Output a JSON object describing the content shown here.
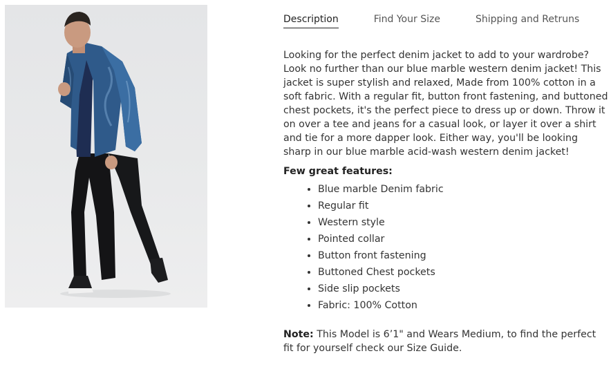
{
  "tabs": [
    {
      "label": "Description",
      "active": true
    },
    {
      "label": "Find Your Size",
      "active": false
    },
    {
      "label": "Shipping and Retruns",
      "active": false
    }
  ],
  "description": "Looking for the perfect denim jacket to add to your wardrobe? Look no further than our blue marble western denim jacket! This jacket is super stylish and relaxed, Made from 100% cotton in a soft fabric. With a regular fit, button front fastening, and buttoned chest pockets, it's the perfect piece to dress up or down. Throw it on over a tee and jeans for a casual look, or layer it over a shirt and tie for a more dapper look. Either way, you'll be looking sharp in our blue marble acid-wash western denim jacket!",
  "features_heading": "Few great features:",
  "features": [
    "Blue marble Denim fabric",
    "Regular fit",
    "Western style",
    "Pointed collar",
    "Button front fastening",
    "Buttoned Chest pockets",
    "Side slip pockets",
    "Fabric: 100% Cotton"
  ],
  "note": {
    "label": "Note:",
    "text": " This Model is 6’1\" and Wears Medium, to find the perfect fit for yourself check our Size Guide."
  },
  "colors": {
    "text": "#333333",
    "image_background": "#e8e9ea",
    "denim": "#2f5a8a"
  }
}
